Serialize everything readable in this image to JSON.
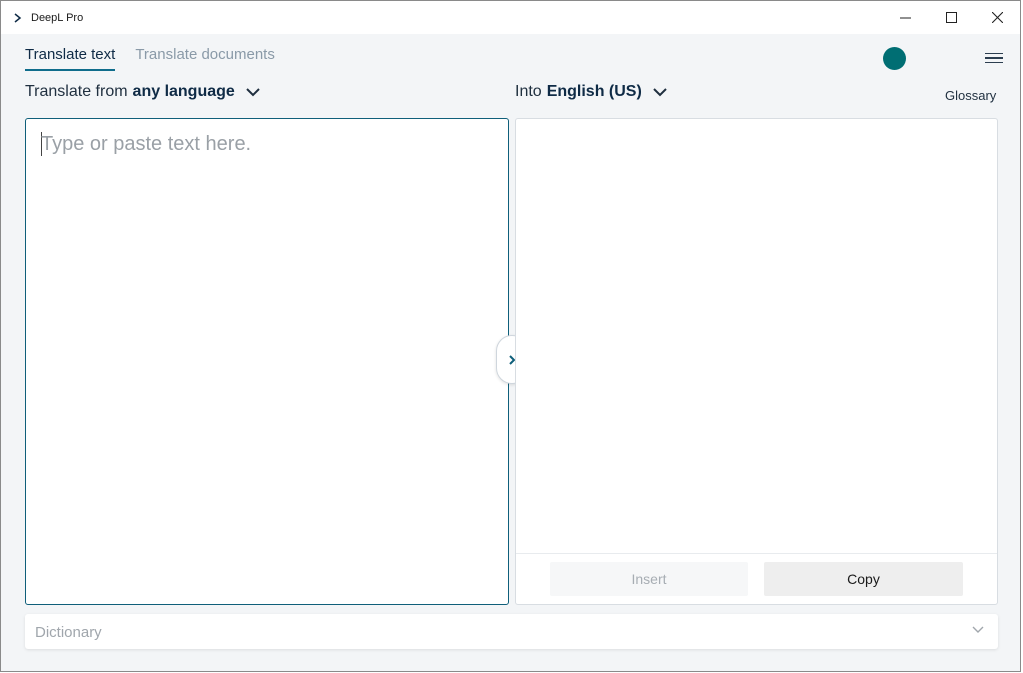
{
  "window": {
    "title": "DeepL Pro",
    "controls": [
      "minimize",
      "maximize",
      "close"
    ]
  },
  "tabs": [
    {
      "label": "Translate text",
      "active": true
    },
    {
      "label": "Translate documents",
      "active": false
    }
  ],
  "status": {
    "color": "#006e73"
  },
  "source": {
    "prefix": "Translate from",
    "language": "any language",
    "placeholder": "Type or paste text here."
  },
  "target": {
    "prefix": "Into",
    "language": "English (US)",
    "glossary_label": "Glossary",
    "insert_label": "Insert",
    "copy_label": "Copy"
  },
  "dictionary": {
    "label": "Dictionary"
  },
  "colors": {
    "accent": "#0f6d8c",
    "navy": "#0f2b46",
    "teal": "#006e73"
  }
}
